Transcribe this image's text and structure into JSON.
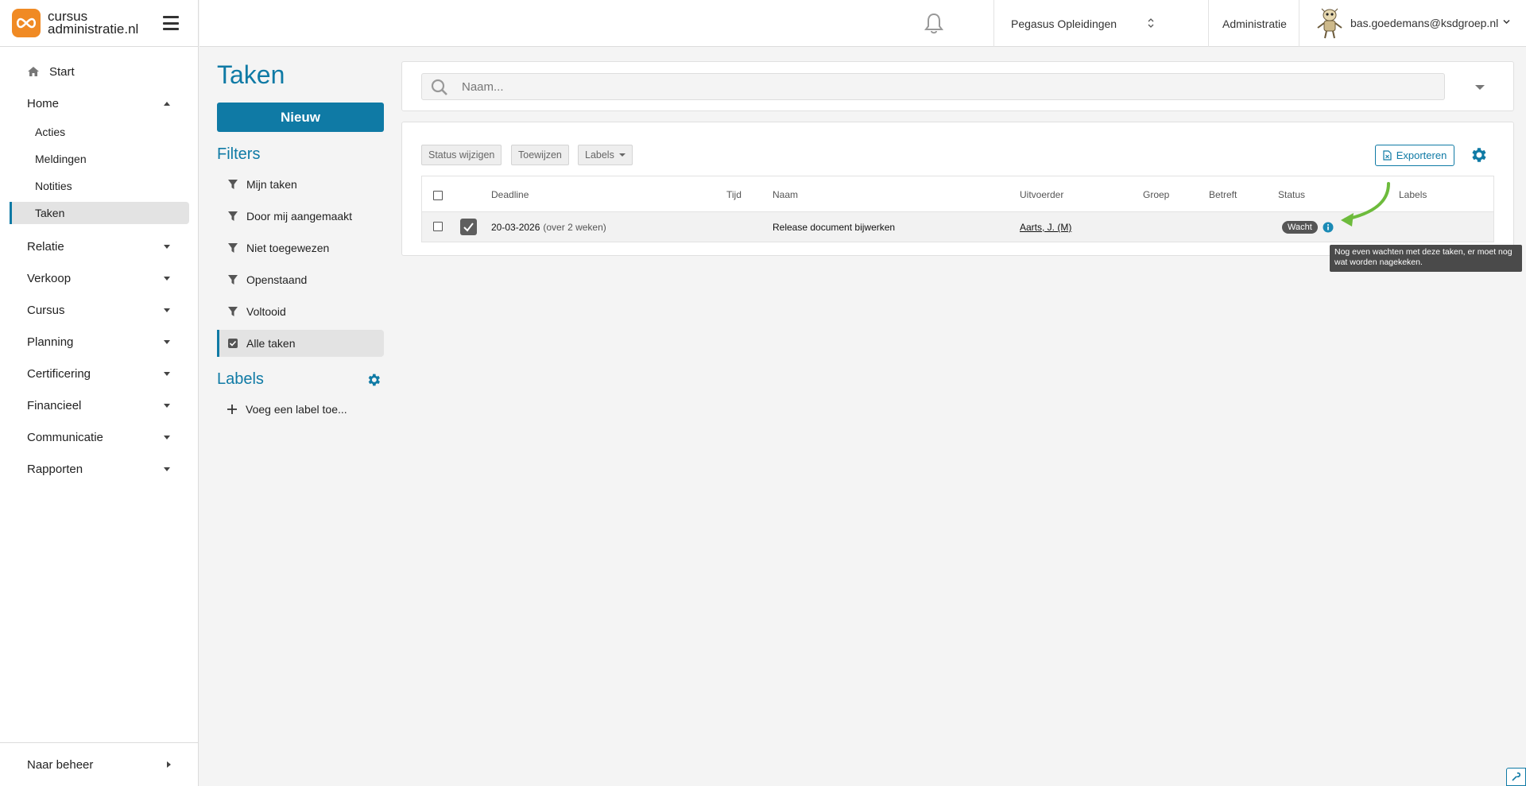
{
  "brand": {
    "line1": "cursus",
    "line2": "administratie.nl"
  },
  "sidebar": {
    "start": "Start",
    "home": "Home",
    "home_sub": [
      "Acties",
      "Meldingen",
      "Notities",
      "Taken"
    ],
    "groups": [
      "Relatie",
      "Verkoop",
      "Cursus",
      "Planning",
      "Certificering",
      "Financieel",
      "Communicatie",
      "Rapporten"
    ],
    "footer": "Naar beheer"
  },
  "topbar": {
    "organisation": "Pegasus Opleidingen",
    "admin": "Administratie",
    "user": "bas.goedemans@ksdgroep.nl"
  },
  "page": {
    "title": "Taken",
    "new_button": "Nieuw",
    "filters_title": "Filters",
    "filters": [
      "Mijn taken",
      "Door mij aangemaakt",
      "Niet toegewezen",
      "Openstaand",
      "Voltooid",
      "Alle taken"
    ],
    "active_filter": "Alle taken",
    "labels_title": "Labels",
    "add_label": "Voeg een label toe..."
  },
  "search": {
    "placeholder": "Naam..."
  },
  "toolbar": {
    "status_button": "Status wijzigen",
    "assign_button": "Toewijzen",
    "labels_button": "Labels",
    "export_button": "Exporteren"
  },
  "table": {
    "columns": [
      "Deadline",
      "Tijd",
      "Naam",
      "Uitvoerder",
      "Groep",
      "Betreft",
      "Status",
      "Labels"
    ],
    "rows": [
      {
        "deadline": "20-03-2026",
        "relative": "(over 2 weken)",
        "time": "",
        "name": "Release document bijwerken",
        "executor": "Aarts, J. (M)",
        "group": "",
        "concerns": "",
        "status": "Wacht",
        "labels": ""
      }
    ]
  },
  "tooltip": {
    "text": "Nog even wachten met deze taken, er moet nog wat worden nagekeken."
  },
  "colors": {
    "accent": "#0f7aa5",
    "brand_orange": "#f08a24",
    "annotation_arrow": "#6dbb3c",
    "badge": "#555555"
  },
  "icons": [
    "menu-icon",
    "home-icon",
    "bell-icon",
    "search-icon",
    "filter-icon",
    "checkbox-icon",
    "gear-icon",
    "plus-icon",
    "export-icon",
    "info-icon",
    "wrench-icon"
  ]
}
